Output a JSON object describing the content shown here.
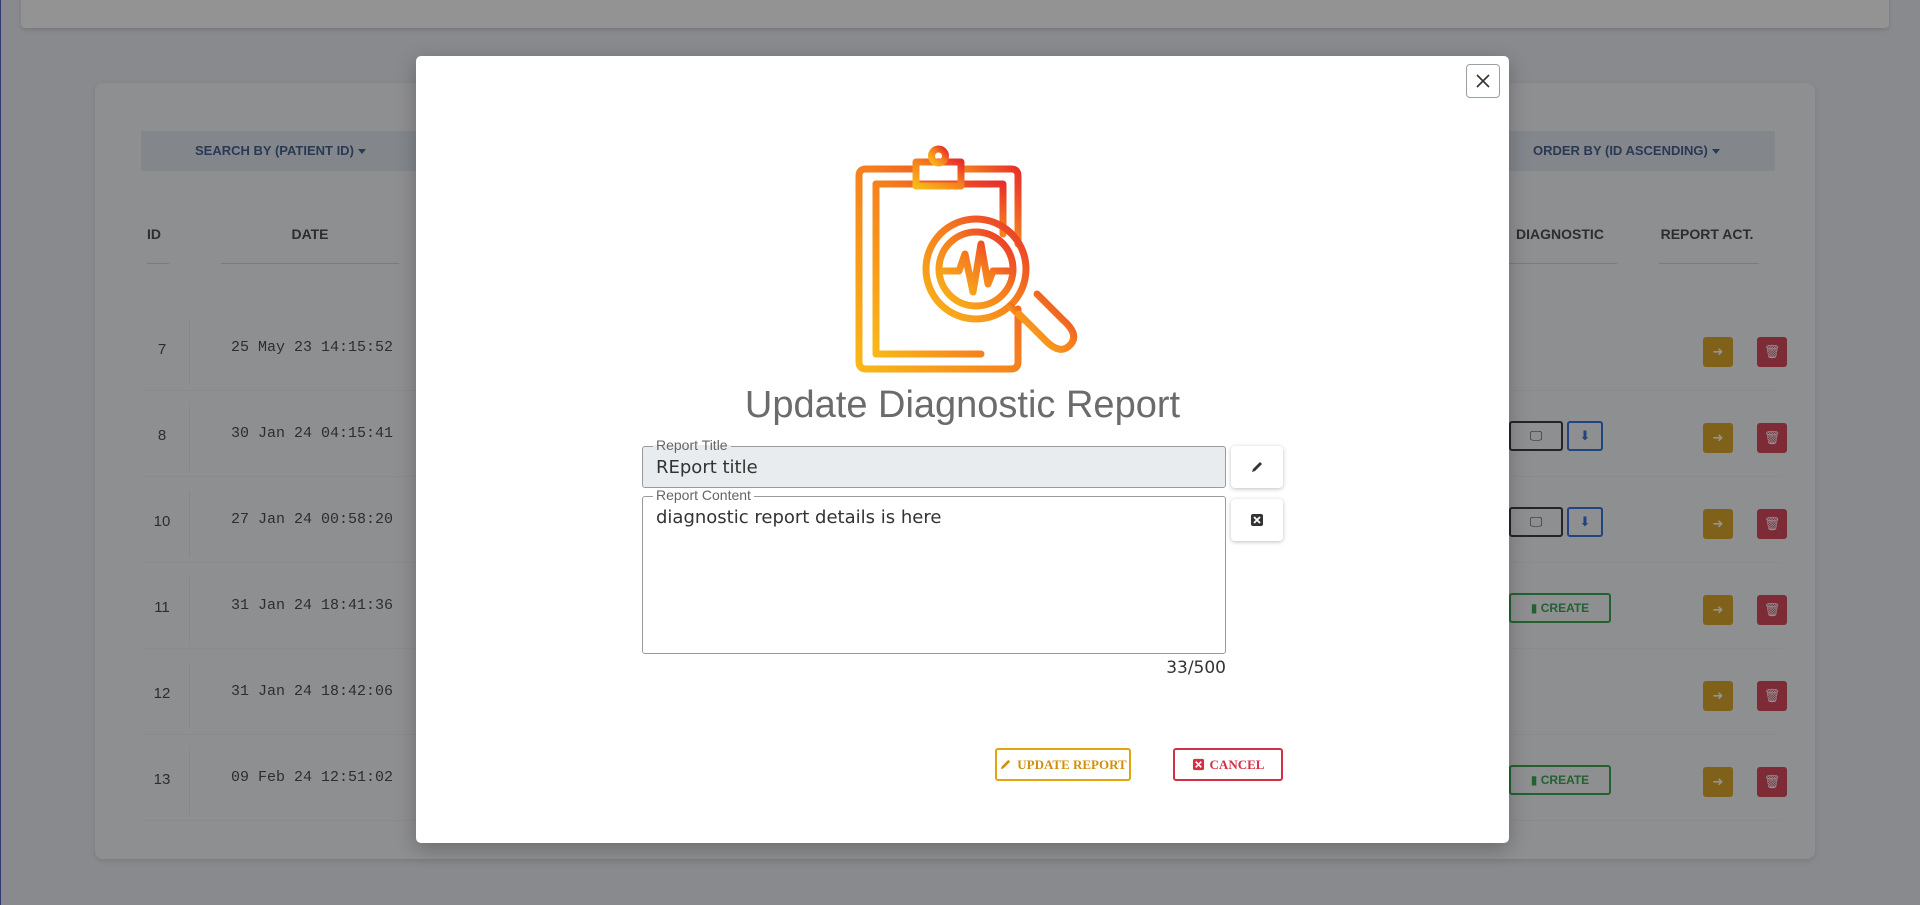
{
  "page": {
    "filters": {
      "search_label": "SEARCH BY (PATIENT ID)",
      "order_label": "ORDER BY (ID ASCENDING)"
    },
    "table": {
      "headers": {
        "id": "ID",
        "date": "DATE",
        "diagnostic": "DIAGNOSTIC",
        "report_act": "REPORT ACT."
      },
      "rows": [
        {
          "id": "7",
          "date": "25 May 23 14:15:52"
        },
        {
          "id": "8",
          "date": "30 Jan 24 04:15:41"
        },
        {
          "id": "10",
          "date": "27 Jan 24 00:58:20"
        },
        {
          "id": "11",
          "date": "31 Jan 24 18:41:36"
        },
        {
          "id": "12",
          "date": "31 Jan 24 18:42:06"
        },
        {
          "id": "13",
          "date": "09 Feb 24 12:51:02"
        }
      ],
      "create_label": "CREATE"
    }
  },
  "modal": {
    "title": "Update Diagnostic Report",
    "report_title": {
      "label": "Report Title",
      "value": "REport title"
    },
    "report_content": {
      "label": "Report Content",
      "value": "diagnostic report details is here"
    },
    "counter": "33/500",
    "update_label": "UPDATE REPORT",
    "cancel_label": "CANCEL"
  },
  "colors": {
    "accent_orange": "#f57c1f",
    "warning": "#e3a412",
    "danger": "#d32f45",
    "success": "#1e9a3a",
    "primary": "#1e5fd6"
  }
}
